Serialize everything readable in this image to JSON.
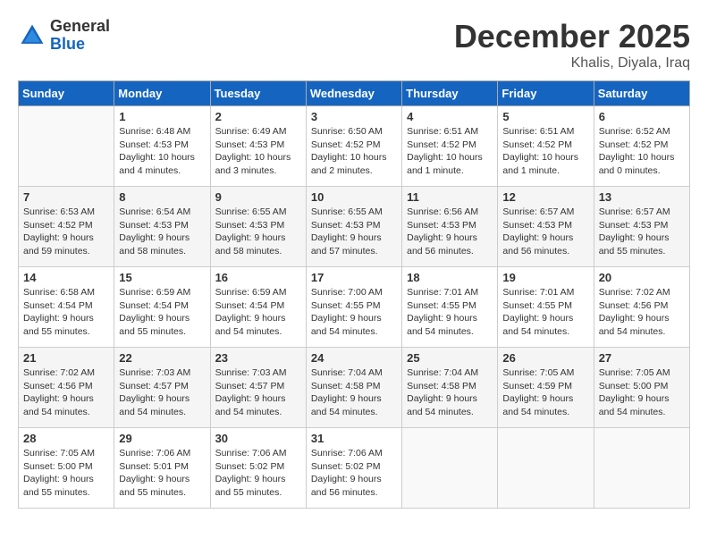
{
  "header": {
    "logo_line1": "General",
    "logo_line2": "Blue",
    "month": "December 2025",
    "location": "Khalis, Diyala, Iraq"
  },
  "weekdays": [
    "Sunday",
    "Monday",
    "Tuesday",
    "Wednesday",
    "Thursday",
    "Friday",
    "Saturday"
  ],
  "weeks": [
    [
      {
        "day": "",
        "info": ""
      },
      {
        "day": "1",
        "info": "Sunrise: 6:48 AM\nSunset: 4:53 PM\nDaylight: 10 hours\nand 4 minutes."
      },
      {
        "day": "2",
        "info": "Sunrise: 6:49 AM\nSunset: 4:53 PM\nDaylight: 10 hours\nand 3 minutes."
      },
      {
        "day": "3",
        "info": "Sunrise: 6:50 AM\nSunset: 4:52 PM\nDaylight: 10 hours\nand 2 minutes."
      },
      {
        "day": "4",
        "info": "Sunrise: 6:51 AM\nSunset: 4:52 PM\nDaylight: 10 hours\nand 1 minute."
      },
      {
        "day": "5",
        "info": "Sunrise: 6:51 AM\nSunset: 4:52 PM\nDaylight: 10 hours\nand 1 minute."
      },
      {
        "day": "6",
        "info": "Sunrise: 6:52 AM\nSunset: 4:52 PM\nDaylight: 10 hours\nand 0 minutes."
      }
    ],
    [
      {
        "day": "7",
        "info": "Sunrise: 6:53 AM\nSunset: 4:52 PM\nDaylight: 9 hours\nand 59 minutes."
      },
      {
        "day": "8",
        "info": "Sunrise: 6:54 AM\nSunset: 4:53 PM\nDaylight: 9 hours\nand 58 minutes."
      },
      {
        "day": "9",
        "info": "Sunrise: 6:55 AM\nSunset: 4:53 PM\nDaylight: 9 hours\nand 58 minutes."
      },
      {
        "day": "10",
        "info": "Sunrise: 6:55 AM\nSunset: 4:53 PM\nDaylight: 9 hours\nand 57 minutes."
      },
      {
        "day": "11",
        "info": "Sunrise: 6:56 AM\nSunset: 4:53 PM\nDaylight: 9 hours\nand 56 minutes."
      },
      {
        "day": "12",
        "info": "Sunrise: 6:57 AM\nSunset: 4:53 PM\nDaylight: 9 hours\nand 56 minutes."
      },
      {
        "day": "13",
        "info": "Sunrise: 6:57 AM\nSunset: 4:53 PM\nDaylight: 9 hours\nand 55 minutes."
      }
    ],
    [
      {
        "day": "14",
        "info": "Sunrise: 6:58 AM\nSunset: 4:54 PM\nDaylight: 9 hours\nand 55 minutes."
      },
      {
        "day": "15",
        "info": "Sunrise: 6:59 AM\nSunset: 4:54 PM\nDaylight: 9 hours\nand 55 minutes."
      },
      {
        "day": "16",
        "info": "Sunrise: 6:59 AM\nSunset: 4:54 PM\nDaylight: 9 hours\nand 54 minutes."
      },
      {
        "day": "17",
        "info": "Sunrise: 7:00 AM\nSunset: 4:55 PM\nDaylight: 9 hours\nand 54 minutes."
      },
      {
        "day": "18",
        "info": "Sunrise: 7:01 AM\nSunset: 4:55 PM\nDaylight: 9 hours\nand 54 minutes."
      },
      {
        "day": "19",
        "info": "Sunrise: 7:01 AM\nSunset: 4:55 PM\nDaylight: 9 hours\nand 54 minutes."
      },
      {
        "day": "20",
        "info": "Sunrise: 7:02 AM\nSunset: 4:56 PM\nDaylight: 9 hours\nand 54 minutes."
      }
    ],
    [
      {
        "day": "21",
        "info": "Sunrise: 7:02 AM\nSunset: 4:56 PM\nDaylight: 9 hours\nand 54 minutes."
      },
      {
        "day": "22",
        "info": "Sunrise: 7:03 AM\nSunset: 4:57 PM\nDaylight: 9 hours\nand 54 minutes."
      },
      {
        "day": "23",
        "info": "Sunrise: 7:03 AM\nSunset: 4:57 PM\nDaylight: 9 hours\nand 54 minutes."
      },
      {
        "day": "24",
        "info": "Sunrise: 7:04 AM\nSunset: 4:58 PM\nDaylight: 9 hours\nand 54 minutes."
      },
      {
        "day": "25",
        "info": "Sunrise: 7:04 AM\nSunset: 4:58 PM\nDaylight: 9 hours\nand 54 minutes."
      },
      {
        "day": "26",
        "info": "Sunrise: 7:05 AM\nSunset: 4:59 PM\nDaylight: 9 hours\nand 54 minutes."
      },
      {
        "day": "27",
        "info": "Sunrise: 7:05 AM\nSunset: 5:00 PM\nDaylight: 9 hours\nand 54 minutes."
      }
    ],
    [
      {
        "day": "28",
        "info": "Sunrise: 7:05 AM\nSunset: 5:00 PM\nDaylight: 9 hours\nand 55 minutes."
      },
      {
        "day": "29",
        "info": "Sunrise: 7:06 AM\nSunset: 5:01 PM\nDaylight: 9 hours\nand 55 minutes."
      },
      {
        "day": "30",
        "info": "Sunrise: 7:06 AM\nSunset: 5:02 PM\nDaylight: 9 hours\nand 55 minutes."
      },
      {
        "day": "31",
        "info": "Sunrise: 7:06 AM\nSunset: 5:02 PM\nDaylight: 9 hours\nand 56 minutes."
      },
      {
        "day": "",
        "info": ""
      },
      {
        "day": "",
        "info": ""
      },
      {
        "day": "",
        "info": ""
      }
    ]
  ]
}
